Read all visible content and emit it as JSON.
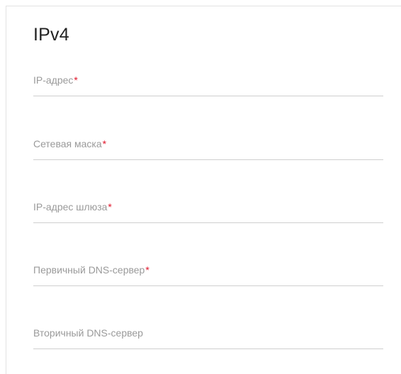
{
  "section": {
    "title": "IPv4"
  },
  "fields": [
    {
      "label": "IP-адрес",
      "required_mark": "*",
      "value": ""
    },
    {
      "label": "Сетевая маска",
      "required_mark": "*",
      "value": ""
    },
    {
      "label": "IP-адрес шлюза",
      "required_mark": "*",
      "value": ""
    },
    {
      "label": "Первичный DNS-сервер",
      "required_mark": "*",
      "value": ""
    },
    {
      "label": "Вторичный DNS-сервер",
      "required_mark": "",
      "value": ""
    }
  ],
  "colors": {
    "required_mark": "#e0152a",
    "label": "#9a9a9a",
    "underline": "#cfcfcf"
  }
}
